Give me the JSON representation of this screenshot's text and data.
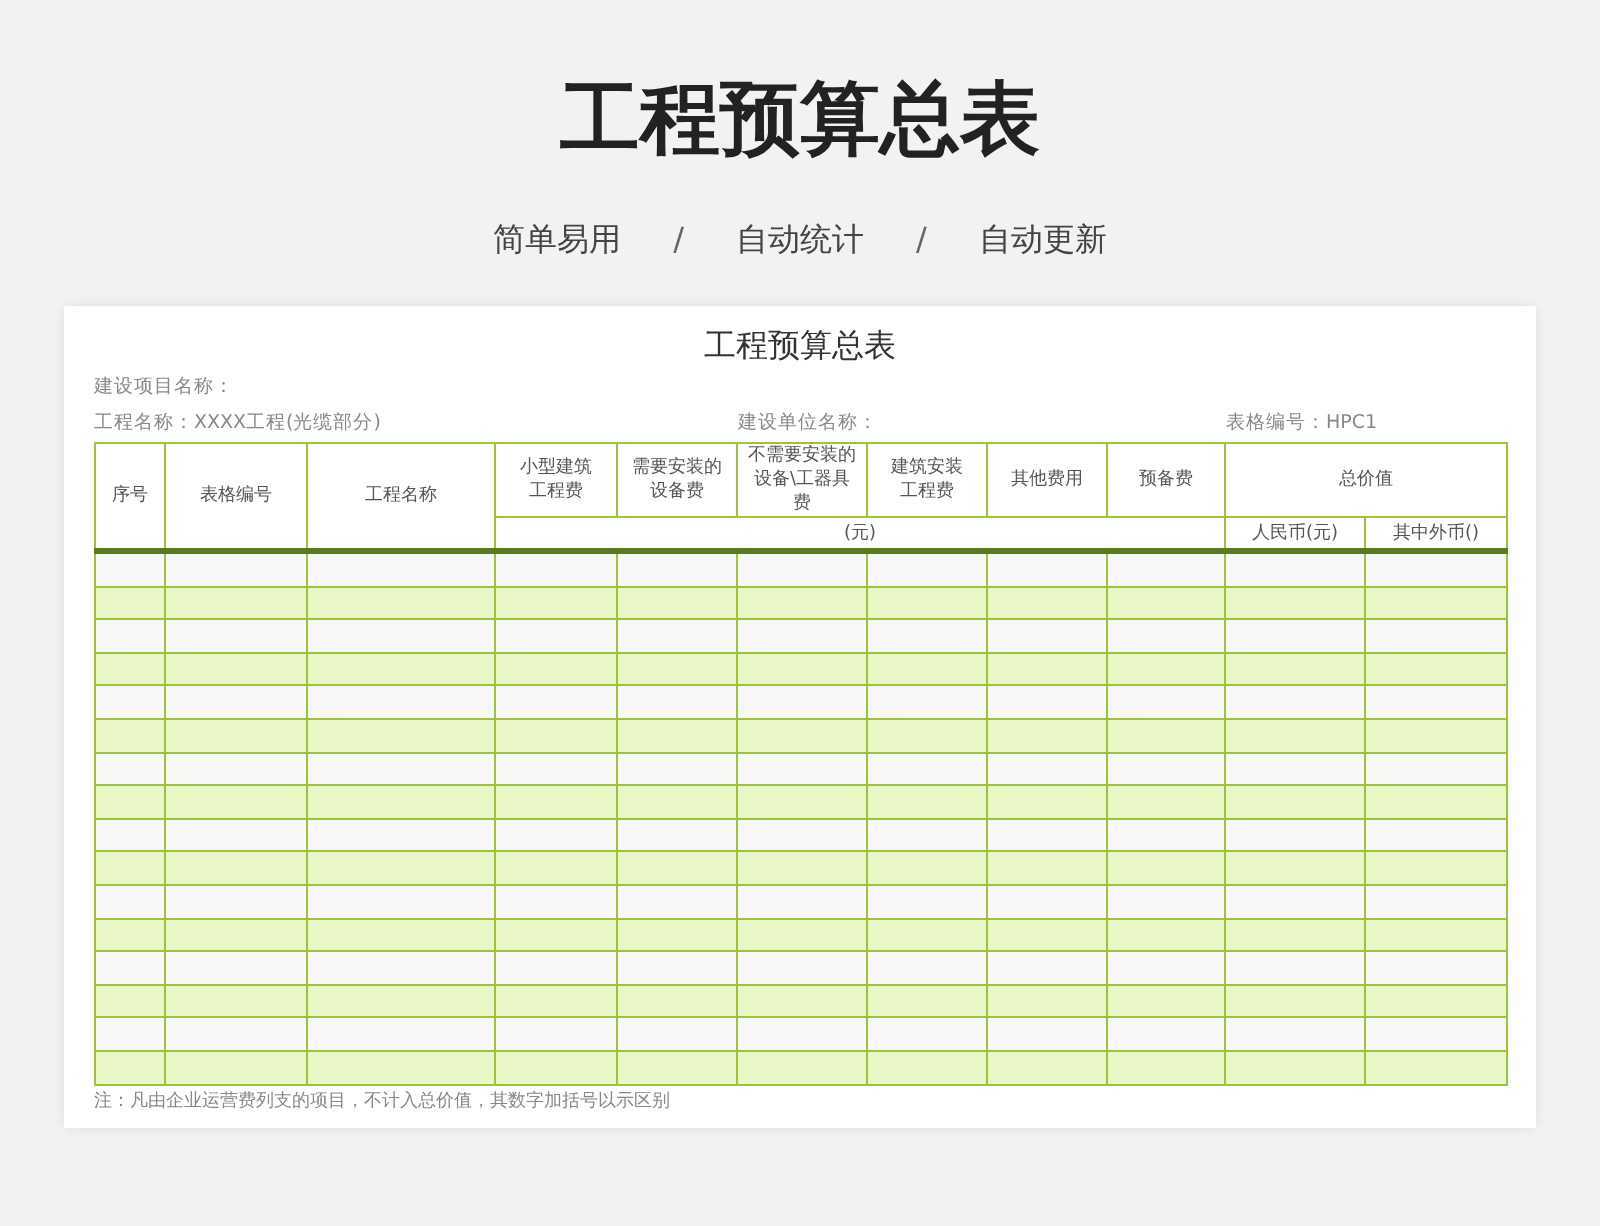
{
  "title": "工程预算总表",
  "taglines": [
    "简单易用",
    "自动统计",
    "自动更新"
  ],
  "separator": "/",
  "sheet": {
    "title": "工程预算总表",
    "project_label": "建设项目名称：",
    "project_name": "工程名称：XXXX工程(光缆部分)",
    "unit_label": "建设单位名称：",
    "form_number": "表格编号：HPC1",
    "columns": [
      {
        "label": "序号"
      },
      {
        "label": "表格编号"
      },
      {
        "label": "工程名称"
      },
      {
        "label": "小型建筑工程费"
      },
      {
        "label": "需要安装的设备费"
      },
      {
        "label": "不需要安装的设备\\工器具费"
      },
      {
        "label": "建筑安装工程费"
      },
      {
        "label": "其他费用"
      },
      {
        "label": "预备费"
      }
    ],
    "group_header": "总价值",
    "unit_note": "(元)",
    "sub_columns": [
      "人民币(元)",
      "其中外币()"
    ],
    "note": "注：凡由企业运营费列支的项目，不计入总价值，其数字加括号以示区别"
  }
}
